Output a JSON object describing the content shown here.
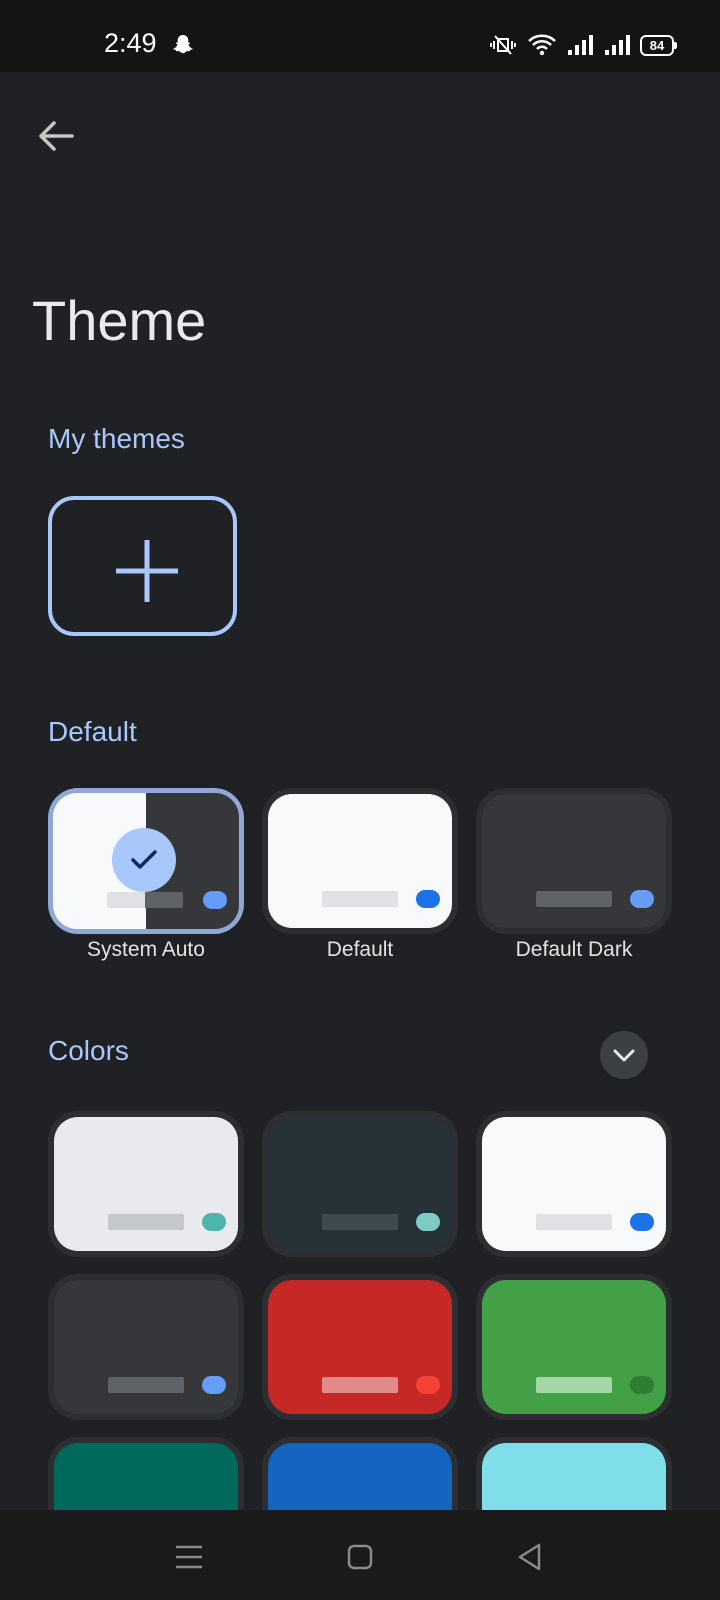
{
  "status_bar": {
    "time": "2:49",
    "battery": "84",
    "icons": [
      "snapchat-icon",
      "vibrate-off-icon",
      "wifi-icon",
      "signal-icon",
      "signal-icon",
      "battery-icon"
    ]
  },
  "header": {
    "title": "Theme",
    "back_icon": "back-arrow-icon"
  },
  "sections": {
    "my_themes": {
      "title": "My themes",
      "add_icon": "plus-icon"
    },
    "default": {
      "title": "Default",
      "items": [
        {
          "label": "System Auto",
          "selected": true
        },
        {
          "label": "Default",
          "selected": false
        },
        {
          "label": "Default Dark",
          "selected": false
        }
      ]
    },
    "colors": {
      "title": "Colors",
      "expand_icon": "chevron-down-icon",
      "swatches": [
        {
          "bg": "#e8eaed",
          "bar": "#c4c7cc",
          "dot": "#4db6ac"
        },
        {
          "bg": "#263238",
          "bar": "#3e4a50",
          "dot": "#80cbc4"
        },
        {
          "bg": "#f8f9fa",
          "bar": "#dfe1e5",
          "dot": "#1a73e8"
        },
        {
          "bg": "#35373b",
          "bar": "#5f6368",
          "dot": "#669df6"
        },
        {
          "bg": "#c62828",
          "bar": "#e08a8a",
          "dot": "#f44336"
        },
        {
          "bg": "#43a047",
          "bar": "#a5d6a7",
          "dot": "#2e7d32"
        },
        {
          "bg": "#00695c",
          "bar": "#4db6ac",
          "dot": "#80cbc4"
        },
        {
          "bg": "#1565c0",
          "bar": "#64b5f6",
          "dot": "#90caf9"
        },
        {
          "bg": "#80deea",
          "bar": "#b2ebf2",
          "dot": "#00acc1"
        }
      ]
    }
  },
  "nav_bar": {
    "icons": [
      "menu-icon",
      "home-icon",
      "back-triangle-icon"
    ]
  }
}
